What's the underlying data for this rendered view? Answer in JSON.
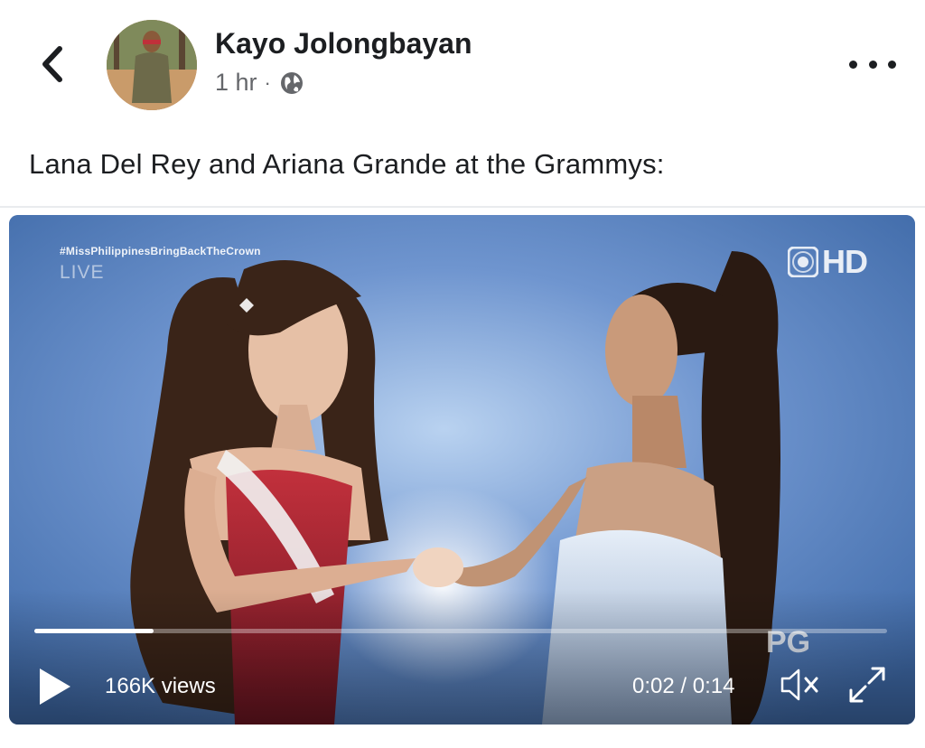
{
  "post": {
    "author": "Kayo Jolongbayan",
    "time": "1 hr",
    "separator": "·",
    "privacy_icon": "globe-icon",
    "text": "Lana Del Rey and Ariana Grande at the Grammys:"
  },
  "video": {
    "overlay_hashtag": "#MissPhilippinesBringBackTheCrown",
    "overlay_live": "LIVE",
    "overlay_hd": "HD",
    "overlay_rating": "PG",
    "views": "166K views",
    "time_display": "0:02 / 0:14",
    "progress": 0.14,
    "icons": [
      "play-icon",
      "speaker-muted-icon",
      "fullscreen-icon"
    ]
  },
  "colors": {
    "video_bg": "#5f86c2",
    "text_primary": "#1c1e21",
    "text_secondary": "#65676b"
  }
}
